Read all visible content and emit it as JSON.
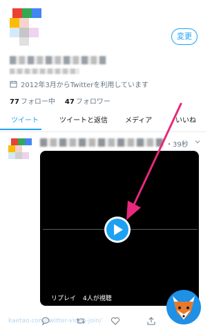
{
  "profile": {
    "edit_button": "変更",
    "joined": "2012年3月からTwitterを利用しています",
    "following_count": "77",
    "following_label": "フォロー中",
    "followers_count": "47",
    "followers_label": "フォロワー"
  },
  "tabs": [
    {
      "label": "ツイート",
      "active": true
    },
    {
      "label": "ツイートと返信",
      "active": false
    },
    {
      "label": "メディア",
      "active": false
    },
    {
      "label": "いいね",
      "active": false
    }
  ],
  "tweet": {
    "time": "・39秒",
    "video": {
      "replay_label": "リプレイ",
      "views_label": "4人が視聴"
    }
  },
  "watermark": "kaetao.com/twitter-video-join/",
  "colors": {
    "accent": "#1da1f2",
    "annotation_arrow": "#e8287a"
  },
  "icons": [
    "calendar-icon",
    "chevron-down-icon",
    "play-icon",
    "reply-icon",
    "retweet-icon",
    "like-icon",
    "share-icon"
  ]
}
